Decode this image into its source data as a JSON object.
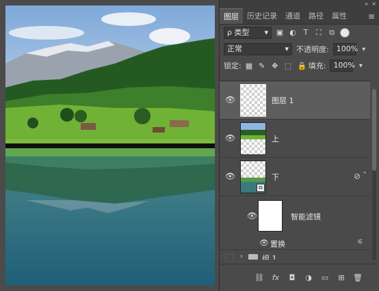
{
  "panel": {
    "tabs": [
      "图层",
      "历史记录",
      "通道",
      "路径",
      "属性"
    ],
    "menu_icon": "hamburger-menu-icon",
    "filter": {
      "label": "ρ 类型"
    },
    "blend": {
      "label": "正常"
    },
    "opacity": {
      "label": "不透明度:",
      "value": "100%"
    },
    "lock": {
      "label": "锁定:"
    },
    "fill": {
      "label": "填充:",
      "value": "100%"
    }
  },
  "layers": {
    "items": [
      {
        "name": "图层 1",
        "selected": true
      },
      {
        "name": "上",
        "selected": false
      },
      {
        "name": "下",
        "selected": false
      }
    ],
    "smart_filters": {
      "name": "智能滤镜"
    },
    "filter_effect": {
      "name": "置换"
    },
    "group": {
      "name": "组 1"
    }
  },
  "colors": {
    "panel_bg": "#4a4a4a",
    "water": "#2e6a82",
    "sky": "#8fb6e0",
    "grass": "#6fb236"
  }
}
